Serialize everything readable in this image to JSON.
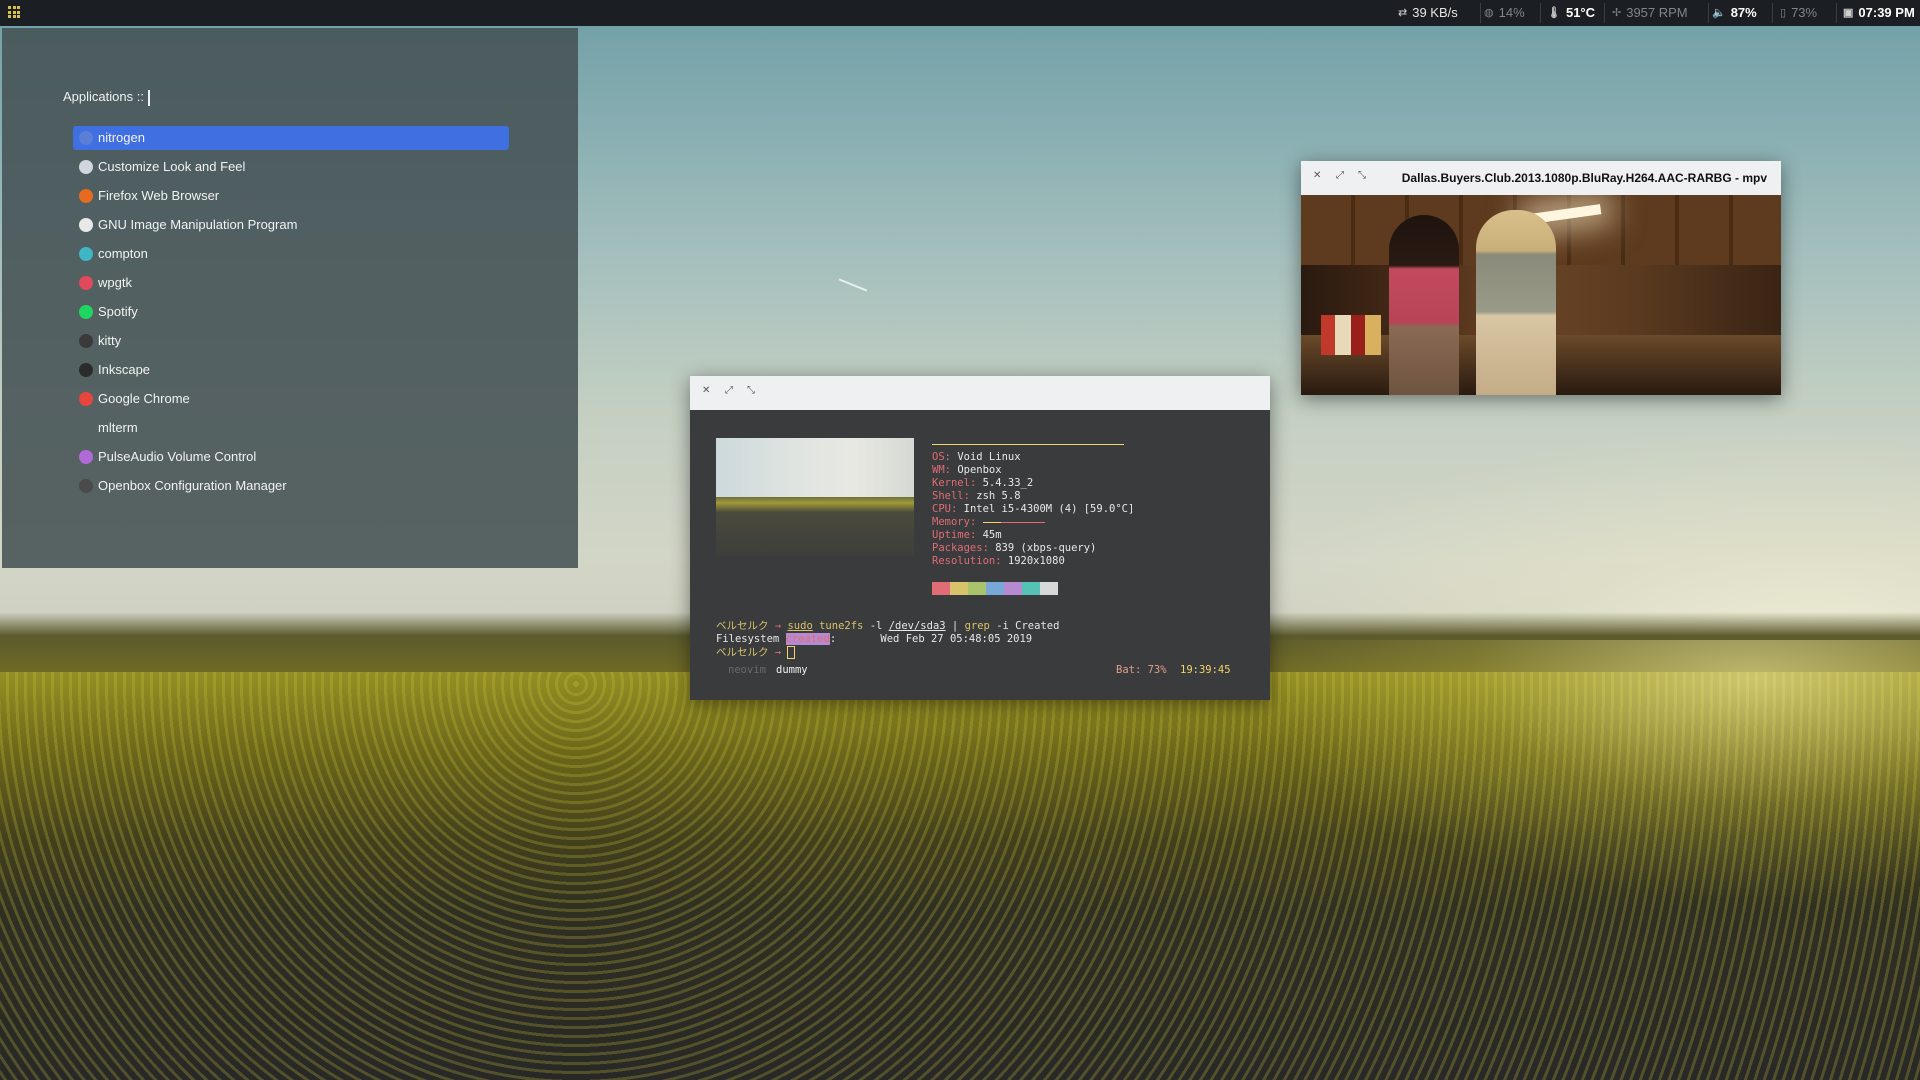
{
  "topbar": {
    "network": {
      "icon": "transfer-icon",
      "value": "39 KB/s"
    },
    "cpu": {
      "icon": "cpu-icon",
      "value": "14%"
    },
    "temp": {
      "icon": "thermometer-icon",
      "value": "51°C"
    },
    "fan": {
      "icon": "fan-icon",
      "value": "3957 RPM"
    },
    "volume": {
      "icon": "speaker-icon",
      "value": "87%"
    },
    "battery": {
      "icon": "battery-icon",
      "value": "73%"
    },
    "clock": {
      "icon": "calendar-icon",
      "value": "07:39 PM"
    }
  },
  "launcher": {
    "prompt": "Applications ::",
    "items": [
      {
        "label": "nitrogen",
        "icon": "nitrogen-icon",
        "color": "#5b7fd6",
        "selected": true
      },
      {
        "label": "Customize Look and Feel",
        "icon": "appearance-icon",
        "color": "#d0d6da"
      },
      {
        "label": "Firefox Web Browser",
        "icon": "firefox-icon",
        "color": "#e66a1f"
      },
      {
        "label": "GNU Image Manipulation Program",
        "icon": "gimp-icon",
        "color": "#e8e8e8"
      },
      {
        "label": "compton",
        "icon": "compton-icon",
        "color": "#3fb6c4"
      },
      {
        "label": "wpgtk",
        "icon": "wpgtk-icon",
        "color": "#e04a5a"
      },
      {
        "label": "Spotify",
        "icon": "spotify-icon",
        "color": "#1ed760"
      },
      {
        "label": "kitty",
        "icon": "kitty-icon",
        "color": "#3a3a3a"
      },
      {
        "label": "Inkscape",
        "icon": "inkscape-icon",
        "color": "#2b2b2b"
      },
      {
        "label": "Google Chrome",
        "icon": "chrome-icon",
        "color": "#e8463c"
      },
      {
        "label": "mlterm",
        "icon": "",
        "color": ""
      },
      {
        "label": "PulseAudio Volume Control",
        "icon": "pulseaudio-icon",
        "color": "#b06ad8"
      },
      {
        "label": "Openbox Configuration Manager",
        "icon": "openbox-icon",
        "color": "#4a4a4a"
      }
    ]
  },
  "terminal": {
    "neofetch": [
      {
        "key": "OS",
        "value": "Void Linux"
      },
      {
        "key": "WM",
        "value": "Openbox"
      },
      {
        "key": "Kernel",
        "value": "5.4.33_2"
      },
      {
        "key": "Shell",
        "value": "zsh 5.8"
      },
      {
        "key": "CPU",
        "value": "Intel i5-4300M (4) [59.0°C]"
      },
      {
        "key": "Memory",
        "value": ""
      },
      {
        "key": "Uptime",
        "value": "45m"
      },
      {
        "key": "Packages",
        "value": "839 (xbps-query)"
      },
      {
        "key": "Resolution",
        "value": "1920x1080"
      }
    ],
    "palette": [
      "#e06c75",
      "#d9c36a",
      "#a9c46a",
      "#78a8d8",
      "#b58ad0",
      "#56c2b6",
      "#d8d8d8"
    ],
    "shell": {
      "prompt_name": "ベルセルク",
      "arrow": "→",
      "cmd_sudo": "sudo",
      "cmd_tune": "tune2fs",
      "cmd_flag": "-l",
      "cmd_dev": "/dev/sda3",
      "cmd_pipe": "|",
      "cmd_grep": "grep",
      "cmd_grep_args": "-i Created",
      "out_label": "Filesystem",
      "out_match": "created",
      "out_colon": ":",
      "out_date": "Wed Feb 27 05:48:05 2019"
    },
    "statusline": {
      "left": "neovim",
      "mid": "dummy",
      "battery": "Bat: 73%",
      "time": "19:39:45"
    }
  },
  "mpv": {
    "title": "Dallas.Buyers.Club.2013.1080p.BluRay.H264.AAC-RARBG - mpv"
  }
}
